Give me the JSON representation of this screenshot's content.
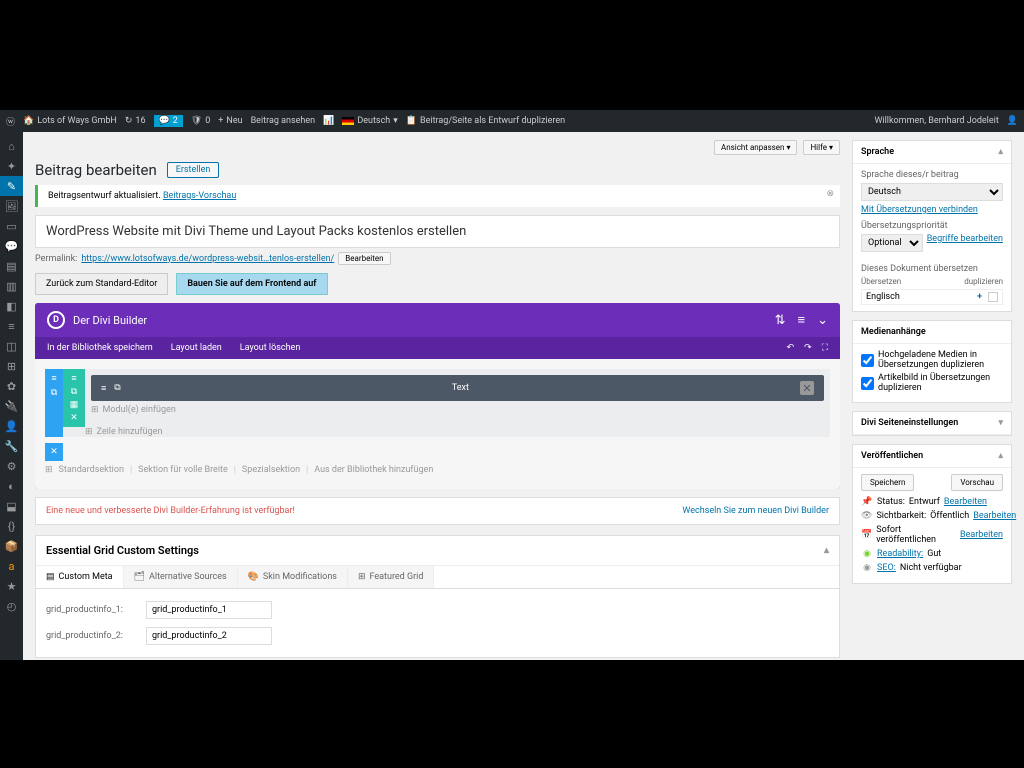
{
  "adminbar": {
    "site": "Lots of Ways GmbH",
    "updates": "16",
    "comments": "2",
    "pending": "0",
    "neu": "Neu",
    "view": "Beitrag ansehen",
    "lang": "Deutsch",
    "dup": "Beitrag/Seite als Entwurf duplizieren",
    "welcome": "Willkommen, Bernhard Jodeleit"
  },
  "topbtns": {
    "custom": "Ansicht anpassen ▾",
    "help": "Hilfe ▾"
  },
  "header": {
    "title": "Beitrag bearbeiten",
    "create": "Erstellen"
  },
  "notice": {
    "text": "Beitragsentwurf aktualisiert.",
    "link": "Beitrags-Vorschau"
  },
  "post": {
    "title": "WordPress Website mit Divi Theme und Layout Packs kostenlos erstellen",
    "perma_label": "Permalink:",
    "perma_url": "https://www.lotsofways.de/wordpress-websit…tenlos-erstellen/",
    "perma_edit": "Bearbeiten"
  },
  "buttons": {
    "std": "Zurück zum Standard-Editor",
    "frontend": "Bauen Sie auf dem Frontend auf"
  },
  "divi": {
    "title": "Der Divi Builder",
    "tabs": {
      "save": "In der Bibliothek speichern",
      "load": "Layout laden",
      "clear": "Layout löschen"
    },
    "module": "Text",
    "addmod": "Modul(e) einfügen",
    "addrow": "Zeile hinzufügen",
    "footer": [
      "Standardsektion",
      "Sektion für volle Breite",
      "Spezialsektion",
      "Aus der Bibliothek hinzufügen"
    ]
  },
  "upgrade": {
    "l": "Eine neue und verbesserte Divi Builder-Erfahrung ist verfügbar!",
    "r": "Wechseln Sie zum neuen Divi Builder"
  },
  "grid": {
    "title": "Essential Grid Custom Settings",
    "tabs": [
      "Custom Meta",
      "Alternative Sources",
      "Skin Modifications",
      "Featured Grid"
    ],
    "rows": [
      {
        "label": "grid_productinfo_1:",
        "value": "grid_productinfo_1"
      },
      {
        "label": "grid_productinfo_2:",
        "value": "grid_productinfo_2"
      }
    ]
  },
  "sprache": {
    "title": "Sprache",
    "label1": "Sprache dieses/r beitrag",
    "lang": "Deutsch",
    "link1": "Mit Übersetzungen verbinden",
    "label2": "Übersetzungspriorität",
    "prio": "Optional",
    "link2": "Begriffe bearbeiten",
    "label3": "Dieses Dokument übersetzen",
    "th1": "Übersetzen",
    "th2": "duplizieren",
    "en": "Englisch"
  },
  "media": {
    "title": "Medienanhänge",
    "c1": "Hochgeladene Medien in Übersetzungen duplizieren",
    "c2": "Artikelbild in Übersetzungen duplizieren"
  },
  "diviside": {
    "title": "Divi Seiteneinstellungen"
  },
  "publish": {
    "title": "Veröffentlichen",
    "save": "Speichern",
    "preview": "Vorschau",
    "status": "Status:",
    "status_v": "Entwurf",
    "status_e": "Bearbeiten",
    "vis": "Sichtbarkeit:",
    "vis_v": "Öffentlich",
    "vis_e": "Bearbeiten",
    "sched": "Sofort veröffentlichen",
    "sched_e": "Bearbeiten",
    "read": "Readability:",
    "read_v": "Gut",
    "seo": "SEO:",
    "seo_v": "Nicht verfügbar"
  }
}
